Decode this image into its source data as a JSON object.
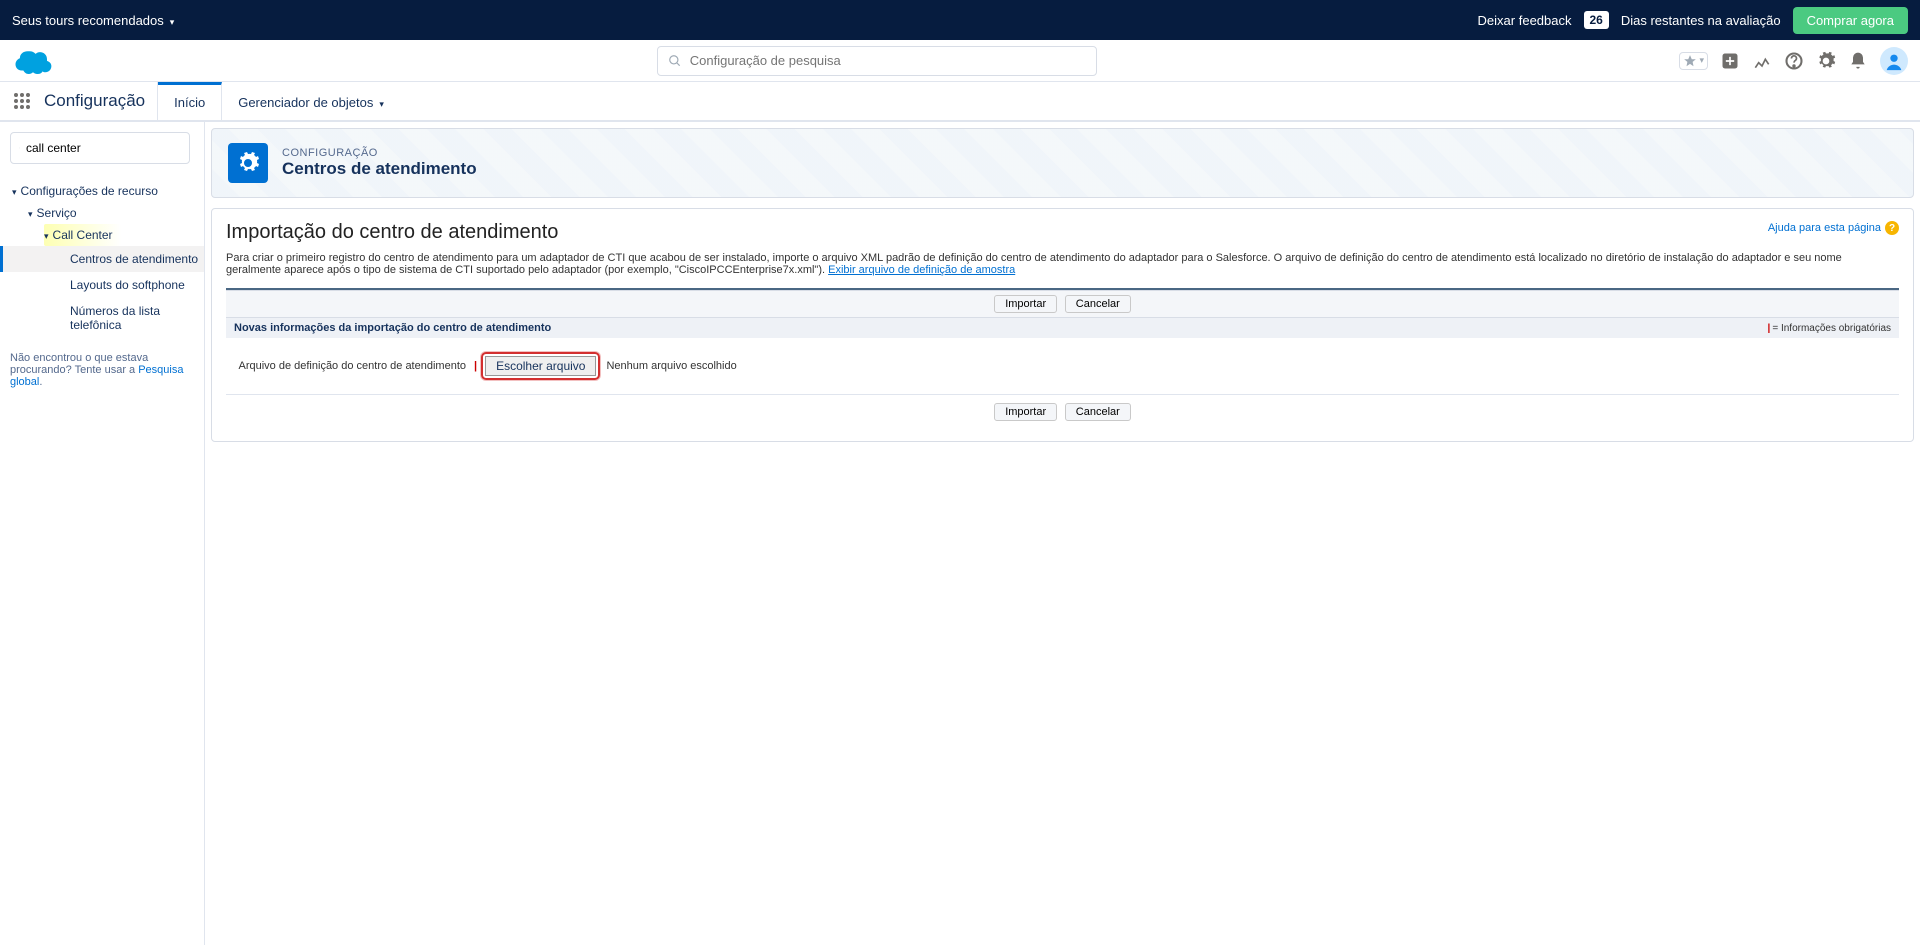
{
  "trial": {
    "tours": "Seus tours recomendados",
    "feedback": "Deixar feedback",
    "days_count": "26",
    "days_label": "Dias restantes na avaliação",
    "buy": "Comprar agora"
  },
  "search": {
    "placeholder": "Configuração de pesquisa"
  },
  "nav": {
    "app": "Configuração",
    "tabs": [
      {
        "label": "Início"
      },
      {
        "label": "Gerenciador de objetos"
      }
    ]
  },
  "sidebar": {
    "search_value": "call center",
    "tree": {
      "root": "Configurações de recurso",
      "service": "Serviço",
      "callcenter": "Call Center",
      "items": [
        "Centros de atendimento",
        "Layouts do softphone",
        "Números da lista telefônica"
      ]
    },
    "help_text": "Não encontrou o que estava procurando? Tente usar a ",
    "help_link": "Pesquisa global",
    "help_suffix": "."
  },
  "page": {
    "eyebrow": "CONFIGURAÇÃO",
    "title": "Centros de atendimento"
  },
  "content": {
    "heading": "Importação do centro de atendimento",
    "help_link": "Ajuda para esta página",
    "description": "Para criar o primeiro registro do centro de atendimento para um adaptador de CTI que acabou de ser instalado, importe o arquivo XML padrão de definição do centro de atendimento do adaptador para o Salesforce. O arquivo de definição do centro de atendimento está localizado no diretório de instalação do adaptador e seu nome geralmente aparece após o tipo de sistema de CTI suportado pelo adaptador (por exemplo, \"CiscoIPCCEnterprise7x.xml\"). ",
    "sample_link": "Exibir arquivo de definição de amostra",
    "import_btn": "Importar",
    "cancel_btn": "Cancelar",
    "section_title": "Novas informações da importação do centro de atendimento",
    "required_legend": "= Informações obrigatórias",
    "field_label": "Arquivo de definição do centro de atendimento",
    "choose_file_btn": "Escolher arquivo",
    "no_file": "Nenhum arquivo escolhido"
  }
}
